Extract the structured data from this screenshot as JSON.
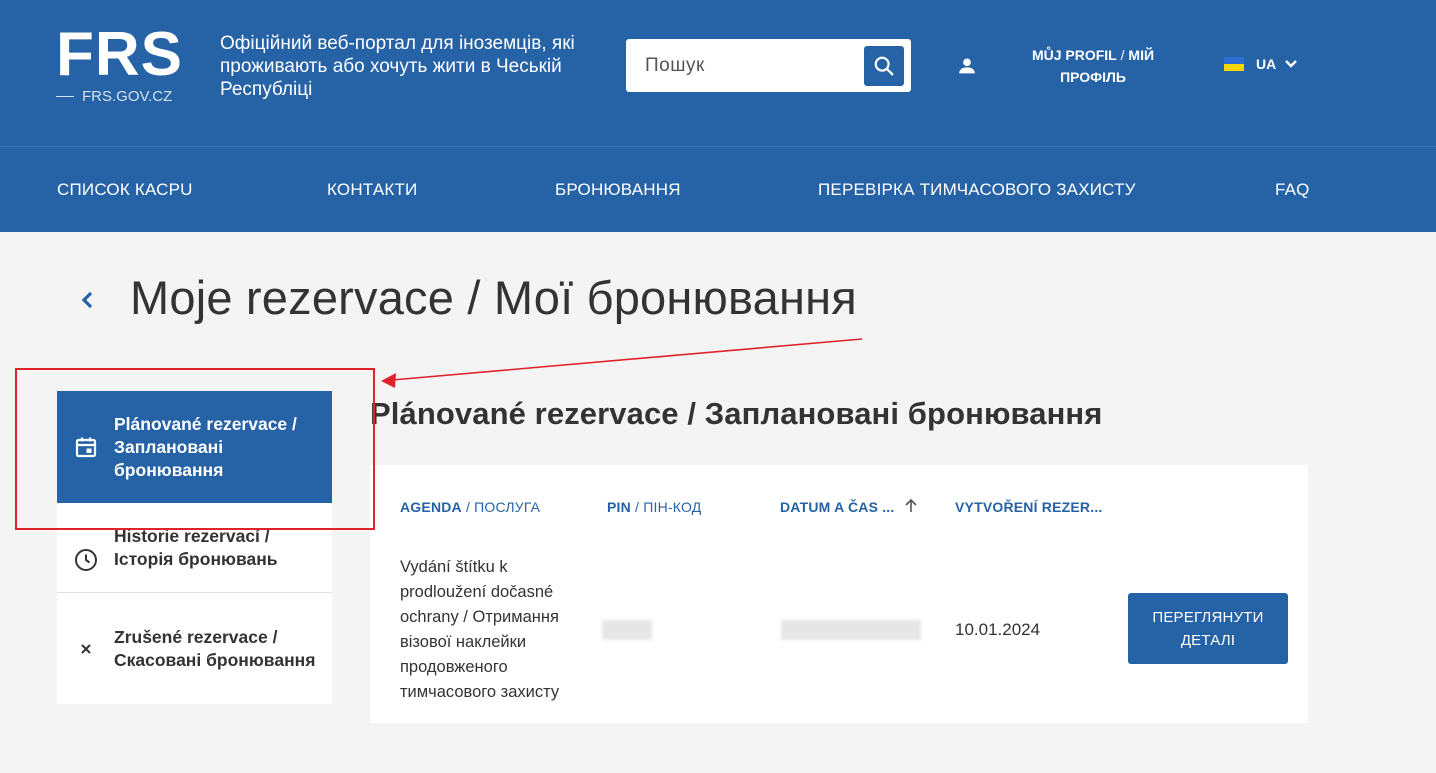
{
  "header": {
    "logo": "FRS",
    "logo_domain": "FRS.GOV.CZ",
    "tagline": "Офіційний веб-портал для іноземців, які проживають або хочуть жити в Чеській Республіці",
    "search_placeholder": "Пошук",
    "profile_label_bold": "MŮJ PROFIL",
    "profile_label_sep": " / ",
    "profile_label_rest": "МІЙ ПРОФІЛЬ",
    "language": "UA"
  },
  "nav": {
    "items": [
      {
        "label": "СПИСОК КАСPU"
      },
      {
        "label": "КОНТАКТИ"
      },
      {
        "label": "БРОНЮВАННЯ"
      },
      {
        "label": "ПЕРЕВІРКА ТИМЧАСОВОГО ЗАХИСТУ"
      },
      {
        "label": "FAQ"
      }
    ]
  },
  "page": {
    "title": "Moje rezervace / Мої бронювання"
  },
  "sidebar": {
    "items": [
      {
        "label": "Plánované rezervace / Заплановані бронювання",
        "icon": "calendar-icon",
        "active": true
      },
      {
        "label": "Historie rezervací / Історія бронювань",
        "icon": "clock-icon",
        "active": false
      },
      {
        "label": "Zrušené rezervace / Скасовані бронювання",
        "icon": "close-icon",
        "active": false
      }
    ]
  },
  "section": {
    "title": "Plánované rezervace / Заплановані бронювання"
  },
  "table": {
    "columns": [
      {
        "bold": "AGENDA",
        "sep": " / ",
        "rest": "ПОСЛУГА"
      },
      {
        "bold": "PIN",
        "sep": " / ",
        "rest": "ПІН-КОД"
      },
      {
        "bold": "DATUM A ČAS ...",
        "sep": "",
        "rest": ""
      },
      {
        "bold": "VYTVOŘENÍ REZER...",
        "sep": "",
        "rest": ""
      }
    ],
    "rows": [
      {
        "service": "Vydání štítku k prodloužení dočasné ochrany / Отримання візової наклейки продовженого тимчасового захисту",
        "created": "10.01.2024",
        "action_label": "ПЕРЕГЛЯНУТИ ДЕТАЛІ"
      }
    ]
  },
  "colors": {
    "brand": "#2662a6",
    "annotation": "#e0232b",
    "background": "#f4f4f4"
  }
}
